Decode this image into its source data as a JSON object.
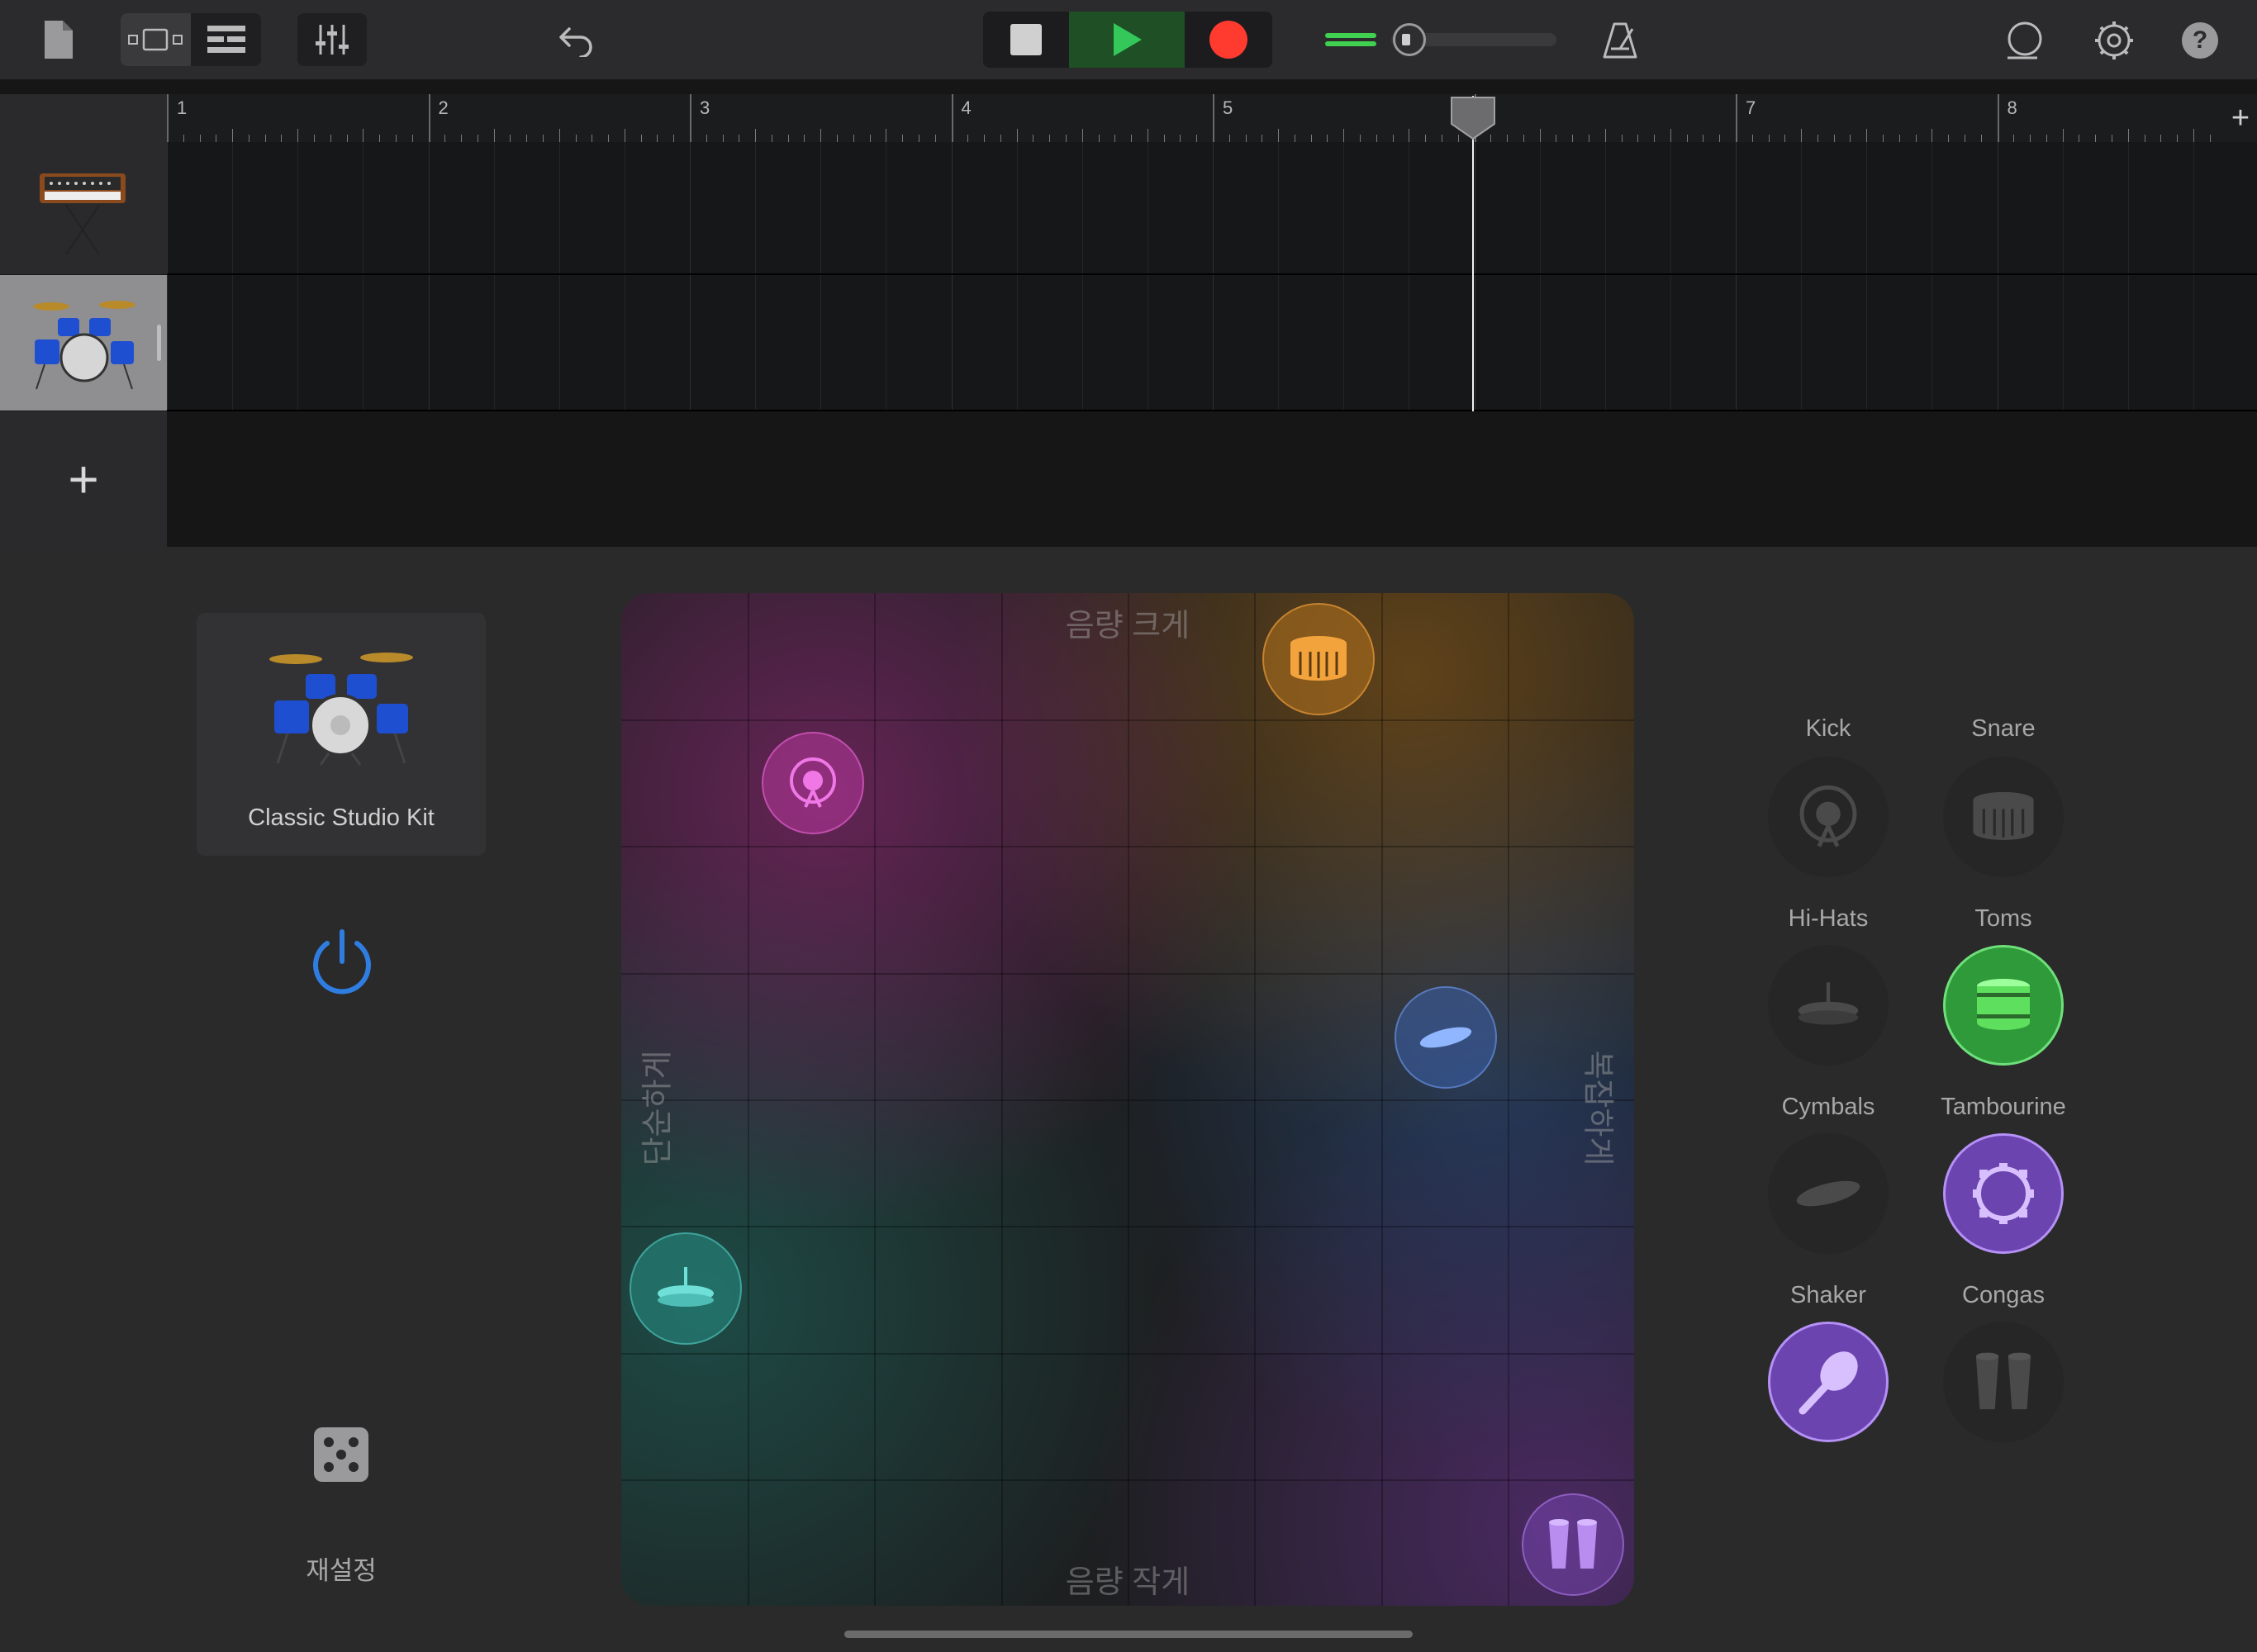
{
  "toolbar": {
    "icons": [
      "document-icon",
      "view-toggle-icon",
      "tracks-view-icon",
      "mixer-icon",
      "undo-icon",
      "stop-icon",
      "play-icon",
      "record-icon",
      "volume-slider",
      "metronome-icon",
      "loop-icon",
      "settings-icon",
      "help-icon"
    ],
    "help_label": "?",
    "accent_play": "#34c759",
    "accent_record": "#ff3b30",
    "volume_level": 0.0
  },
  "ruler": {
    "bars": [
      "1",
      "2",
      "3",
      "4",
      "5",
      "6",
      "7",
      "8"
    ],
    "add_label": "+"
  },
  "tracks": [
    {
      "name": "synthesizer-track",
      "icon": "synth-keyboard-icon",
      "selected": false
    },
    {
      "name": "drums-track",
      "icon": "drum-kit-icon",
      "selected": true
    }
  ],
  "add_track_label": "+",
  "kit": {
    "name": "Classic Studio Kit",
    "reset_label": "재설정"
  },
  "pad": {
    "top_label": "음량 크게",
    "bottom_label": "음량 작게",
    "left_label": "단순하게",
    "right_label": "복잡하게"
  },
  "instruments": [
    {
      "label": "Kick",
      "active": false,
      "color": "#5a5a5a"
    },
    {
      "label": "Snare",
      "active": false,
      "color": "#5a5a5a"
    },
    {
      "label": "Hi-Hats",
      "active": false,
      "color": "#5a5a5a"
    },
    {
      "label": "Toms",
      "active": true,
      "color": "#3fbf3f"
    },
    {
      "label": "Cymbals",
      "active": false,
      "color": "#5a5a5a"
    },
    {
      "label": "Tambourine",
      "active": true,
      "color": "#8a5ad6"
    },
    {
      "label": "Shaker",
      "active": true,
      "color": "#8a5ad6"
    },
    {
      "label": "Congas",
      "active": false,
      "color": "#5a5a5a"
    }
  ]
}
